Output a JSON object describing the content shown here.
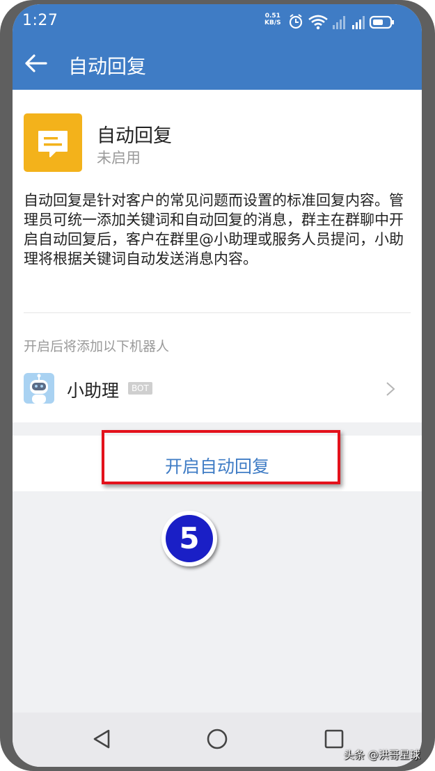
{
  "status_bar": {
    "time": "1:27",
    "net_speed_value": "0.51",
    "net_speed_unit": "KB/S"
  },
  "app_bar": {
    "back_icon": "arrow-left-icon",
    "title": "自动回复"
  },
  "feature": {
    "icon": "message-icon",
    "icon_color": "#f3b21b",
    "name": "自动回复",
    "status": "未启用",
    "description": "自动回复是针对客户的常见问题而设置的标准回复内容。管理员可统一添加关键词和自动回复的消息，群主在群聊中开启自动回复后，客户在群里@小助理或服务人员提问，小助理将根据关键词自动发送消息内容。"
  },
  "robots": {
    "section_label": "开启后将添加以下机器人",
    "items": [
      {
        "name": "小助理",
        "badge": "BOT"
      }
    ]
  },
  "action": {
    "label": "开启自动回复"
  },
  "annotation": {
    "step_number": "5",
    "highlight_color": "#e3111b"
  },
  "nav_bar": {
    "back": "triangle-back-icon",
    "home": "circle-home-icon",
    "recents": "square-recents-icon"
  },
  "watermark": "头条 @洪哥星球",
  "colors": {
    "primary": "#3f7cc5",
    "background": "#f0f1f3"
  }
}
